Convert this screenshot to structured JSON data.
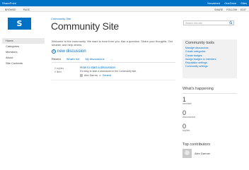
{
  "suitebar": {
    "brand": "SharePoint",
    "links": [
      "Newsfeed",
      "OneDrive",
      "Sites"
    ]
  },
  "ribbon": {
    "tabs": [
      "Browse",
      "Page"
    ],
    "actions": [
      "Share",
      "Follow",
      "Edit"
    ]
  },
  "header": {
    "breadcrumb": "Community Site",
    "title": "Community Site",
    "search_placeholder": "Search this site"
  },
  "leftnav": {
    "items": [
      {
        "label": "Home",
        "selected": true
      },
      {
        "label": "Categories",
        "selected": false
      },
      {
        "label": "Members",
        "selected": false
      },
      {
        "label": "About",
        "selected": false
      },
      {
        "label": "Site Contents",
        "selected": false
      }
    ]
  },
  "main": {
    "welcome": "Welcome to the community. We want to hear from you. Ask a question. Share your thoughts. Get smarter and help others.",
    "new_discussion": "new discussion",
    "views": [
      "Recent",
      "What's hot",
      "My discussions",
      "..."
    ],
    "discussion": {
      "replies": "0",
      "replies_label": "replies",
      "likes": "0",
      "likes_label": "likes",
      "title": "How to start a discussion",
      "description": "It's easy to start a discussion in the Community site.",
      "author": "Alex Darrow",
      "in_label": "in",
      "category": "General"
    }
  },
  "tools": {
    "heading": "Community tools",
    "links": [
      "Manage discussions",
      "Create categories",
      "Create badges",
      "Assign badges to members",
      "Reputation settings",
      "Community settings"
    ]
  },
  "happening": {
    "heading": "What's happening",
    "stats": [
      {
        "value": "1",
        "label": "member"
      },
      {
        "value": "0",
        "label": "discussions"
      },
      {
        "value": "0",
        "label": "replies"
      }
    ]
  },
  "contributors": {
    "heading": "Top contributors",
    "name": "Alex Darrow"
  }
}
